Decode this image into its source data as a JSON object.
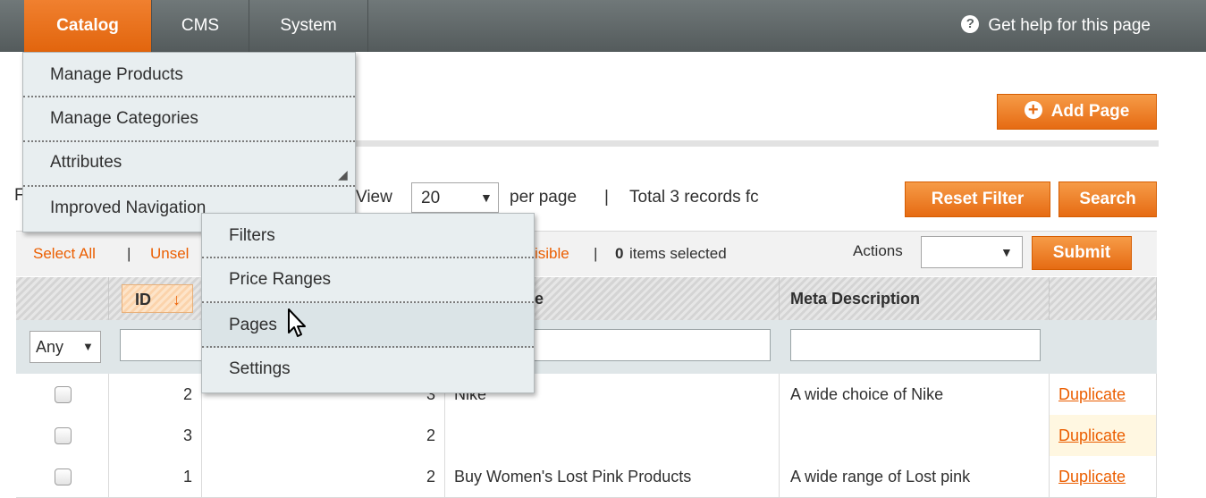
{
  "topnav": {
    "tabs": [
      {
        "label": "Catalog",
        "active": true
      },
      {
        "label": "CMS",
        "active": false
      },
      {
        "label": "System",
        "active": false
      }
    ],
    "help_label": "Get help for this page",
    "help_icon": "question-circle-icon"
  },
  "catalog_menu": {
    "items": [
      "Manage Products",
      "Manage Categories",
      "Attributes",
      "Improved Navigation"
    ]
  },
  "submenu": {
    "items": [
      "Filters",
      "Price Ranges",
      "Pages",
      "Settings"
    ],
    "hovered": "Pages"
  },
  "header": {
    "add_button": "Add Page",
    "add_icon": "plus-circle-icon"
  },
  "pager": {
    "view_label": "View",
    "per_page_value": "20",
    "per_page_label": "per page",
    "separator": "|",
    "total_text": "Total 3 records fc",
    "left_fragment": "F"
  },
  "filters": {
    "reset_label": "Reset Filter",
    "search_label": "Search"
  },
  "massaction": {
    "select_all": "Select All",
    "separator": "|",
    "unselect_fragment": "Unsel",
    "visible_fragment": "isible",
    "selected_count": "0",
    "selected_suffix": "items selected",
    "actions_label": "Actions",
    "submit_label": "Submit"
  },
  "grid": {
    "headers": {
      "id": "ID",
      "sort_icon": "arrow-down-icon",
      "title_fragment": "e",
      "meta_description": "Meta Description"
    },
    "filter_any": "Any",
    "rows": [
      {
        "id": "2",
        "count": "3",
        "title": "Nike",
        "meta": "A wide choice of Nike",
        "action": "Duplicate"
      },
      {
        "id": "3",
        "count": "2",
        "title": "",
        "meta": "",
        "action": "Duplicate"
      },
      {
        "id": "1",
        "count": "2",
        "title": "Buy Women's Lost Pink Products",
        "meta": "A wide range of Lost pink",
        "action": "Duplicate"
      }
    ]
  },
  "colors": {
    "accent": "#eb5e00",
    "nav_bg": "#646b6c",
    "menu_bg": "#e8eef0"
  }
}
